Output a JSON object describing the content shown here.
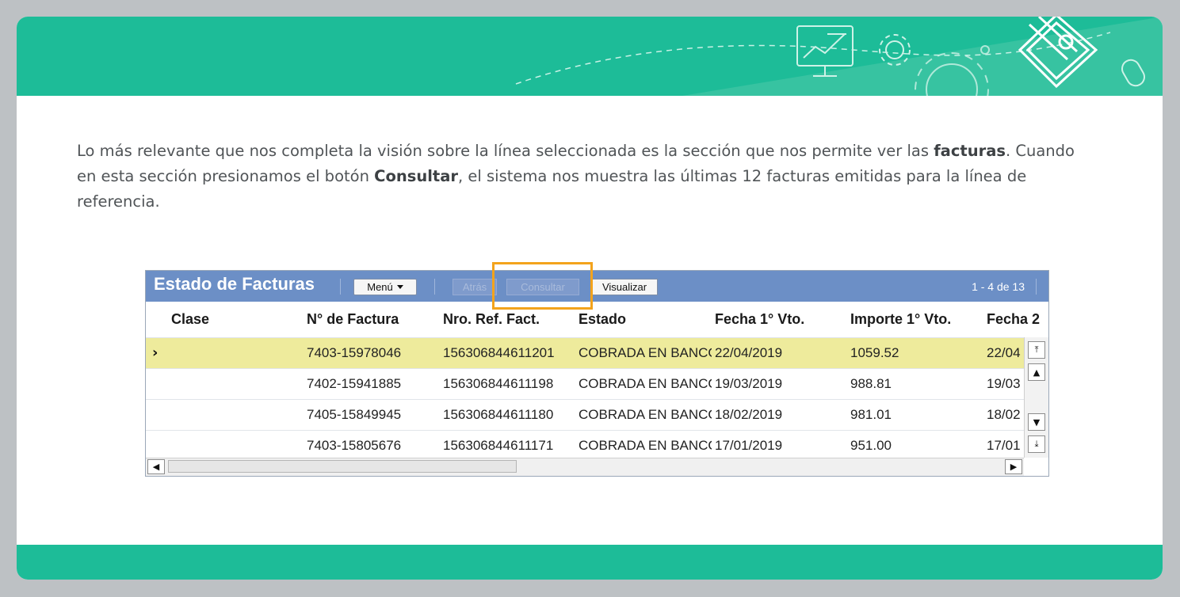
{
  "intro": {
    "part1": "Lo más relevante que nos completa la visión sobre la línea seleccionada es la sección que nos permite ver las ",
    "bold1": "facturas",
    "part2": ". Cuando en esta sección presionamos el botón ",
    "bold2": "Consultar",
    "part3": ", el sistema nos muestra las últimas 12 facturas emitidas para la línea de referencia."
  },
  "window": {
    "title": "Estado de Facturas",
    "menu_label": "Menú",
    "back_label": "Atrás",
    "consult_label": "Consultar",
    "view_label": "Visualizar",
    "pager": "1 - 4 de 13"
  },
  "table": {
    "columns": [
      "Clase",
      "N° de Factura",
      "Nro. Ref. Fact.",
      "Estado",
      "Fecha 1° Vto.",
      "Importe 1° Vto.",
      "Fecha 2"
    ],
    "rows": [
      {
        "clase": "",
        "factura": "7403-15978046",
        "ref": "156306844611201",
        "estado": "COBRADA EN BANCO",
        "fecha1": "22/04/2019",
        "importe1": "1059.52",
        "fecha2": "22/04"
      },
      {
        "clase": "",
        "factura": "7402-15941885",
        "ref": "156306844611198",
        "estado": "COBRADA EN BANCO",
        "fecha1": "19/03/2019",
        "importe1": "988.81",
        "fecha2": "19/03"
      },
      {
        "clase": "",
        "factura": "7405-15849945",
        "ref": "156306844611180",
        "estado": "COBRADA EN BANCO",
        "fecha1": "18/02/2019",
        "importe1": "981.01",
        "fecha2": "18/02"
      },
      {
        "clase": "",
        "factura": "7403-15805676",
        "ref": "156306844611171",
        "estado": "COBRADA EN BANCO",
        "fecha1": "17/01/2019",
        "importe1": "951.00",
        "fecha2": "17/01"
      }
    ],
    "selected_row_color": "#eeeb9c"
  },
  "colors": {
    "brand_teal": "#1dbc98",
    "titlebar_blue": "#6c8fc6",
    "highlight_orange": "#f3a31c"
  },
  "icons": [
    "monitor-chart-icon",
    "gear-icon",
    "large-gear-icon",
    "pencil-puzzle-logo-icon",
    "mouse-icon"
  ]
}
